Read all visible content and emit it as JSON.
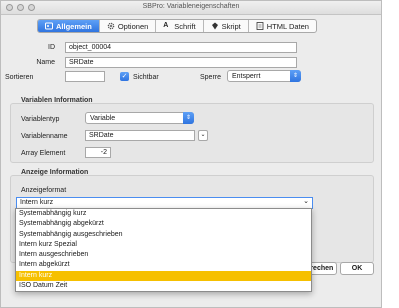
{
  "window": {
    "title": "SBPro: Variableneigenschaften"
  },
  "tabs": [
    {
      "label": "Allgemein",
      "icon": "id-icon",
      "active": true
    },
    {
      "label": "Optionen",
      "icon": "gear-icon",
      "active": false
    },
    {
      "label": "Schrift",
      "icon": "font-icon",
      "active": false
    },
    {
      "label": "Skript",
      "icon": "script-icon",
      "active": false
    },
    {
      "label": "HTML Daten",
      "icon": "html-icon",
      "active": false
    }
  ],
  "general": {
    "id_label": "ID",
    "id_value": "object_00004",
    "name_label": "Name",
    "name_value": "SRDate",
    "sort_label": "Sortieren",
    "sort_value": "",
    "visible_label": "Sichtbar",
    "lock_label": "Sperre",
    "lock_value": "Entsperrt"
  },
  "variable_info": {
    "title": "Variablen Information",
    "type_label": "Variablentyp",
    "type_value": "Variable",
    "name_label": "Variablenname",
    "name_value": "SRDate",
    "element_label": "Array Element",
    "element_value": "-2"
  },
  "display_info": {
    "title": "Anzeige Information",
    "format_label": "Anzeigeformat",
    "format_value": "Intern kurz",
    "options": [
      "Systemabhängig kurz",
      "Systemabhängig abgekürzt",
      "Systemabhängig ausgeschrieben",
      "Intern kurz Spezial",
      "Intern ausgeschrieben",
      "Intern abgekürzt",
      "Intern kurz",
      "ISO Datum Zeit"
    ],
    "highlighted_index": 6
  },
  "buttons": {
    "cancel": "Abbrechen",
    "ok": "OK"
  },
  "colors": {
    "accent": "#2f74e0",
    "highlight": "#f6c000"
  }
}
